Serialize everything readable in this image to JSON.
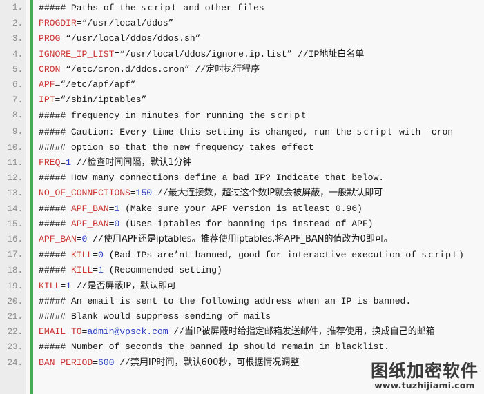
{
  "editor": {
    "title": "ddos.conf configuration listing",
    "colors": {
      "gutter_background": "#ececec",
      "gutter_rule": "#45ab57",
      "page_background": "#f8f8f8",
      "variable": "#cc3333",
      "number": "#2d3fc4",
      "text": "#161616",
      "lineno": "#8d8d8d"
    },
    "line_number_suffix": ".",
    "lines": [
      {
        "number": "1.",
        "tokens": [
          {
            "type": "plain",
            "text": "##### Paths of the "
          },
          {
            "type": "script",
            "text": "script"
          },
          {
            "type": "plain",
            "text": " and other files"
          }
        ]
      },
      {
        "number": "2.",
        "tokens": [
          {
            "type": "var",
            "text": "PROGDIR"
          },
          {
            "type": "plain",
            "text": "=“/usr/local/ddos”"
          }
        ]
      },
      {
        "number": "3.",
        "tokens": [
          {
            "type": "var",
            "text": "PROG"
          },
          {
            "type": "plain",
            "text": "=“/usr/local/ddos/ddos.sh”"
          }
        ]
      },
      {
        "number": "4.",
        "tokens": [
          {
            "type": "var",
            "text": "IGNORE_IP_LIST"
          },
          {
            "type": "plain",
            "text": "=“/usr/local/ddos/ignore.ip.list” //IP"
          },
          {
            "type": "cjk",
            "text": "地址白名单"
          }
        ]
      },
      {
        "number": "5.",
        "tokens": [
          {
            "type": "var",
            "text": "CRON"
          },
          {
            "type": "plain",
            "text": "=“/etc/cron.d/ddos.cron” //"
          },
          {
            "type": "cjk",
            "text": "定时执行程序"
          }
        ]
      },
      {
        "number": "6.",
        "tokens": [
          {
            "type": "var",
            "text": "APF"
          },
          {
            "type": "plain",
            "text": "=“/etc/apf/apf”"
          }
        ]
      },
      {
        "number": "7.",
        "tokens": [
          {
            "type": "var",
            "text": "IPT"
          },
          {
            "type": "plain",
            "text": "=“/sbin/iptables”"
          }
        ]
      },
      {
        "number": "8.",
        "tokens": [
          {
            "type": "plain",
            "text": "##### frequency in minutes for running the "
          },
          {
            "type": "script",
            "text": "script"
          }
        ]
      },
      {
        "number": "9.",
        "tokens": [
          {
            "type": "plain",
            "text": "##### Caution: Every time this setting is changed, run the "
          },
          {
            "type": "script",
            "text": "script"
          },
          {
            "type": "plain",
            "text": " with -cron"
          }
        ]
      },
      {
        "number": "10.",
        "tokens": [
          {
            "type": "plain",
            "text": "##### option so that the new frequency takes effect"
          }
        ]
      },
      {
        "number": "11.",
        "tokens": [
          {
            "type": "var",
            "text": "FREQ"
          },
          {
            "type": "plain",
            "text": "="
          },
          {
            "type": "num",
            "text": "1"
          },
          {
            "type": "plain",
            "text": " //"
          },
          {
            "type": "cjk",
            "text": "检查时间间隔，默认1分钟"
          }
        ]
      },
      {
        "number": "12.",
        "tokens": [
          {
            "type": "plain",
            "text": "##### How many connections define a bad IP? Indicate that below."
          }
        ]
      },
      {
        "number": "13.",
        "tokens": [
          {
            "type": "var",
            "text": "NO_OF_CONNECTIONS"
          },
          {
            "type": "plain",
            "text": "="
          },
          {
            "type": "num",
            "text": "150"
          },
          {
            "type": "plain",
            "text": " //"
          },
          {
            "type": "cjk",
            "text": "最大连接数，超过这个数IP就会被屏蔽，一般默认即可"
          }
        ]
      },
      {
        "number": "14.",
        "tokens": [
          {
            "type": "plain",
            "text": "##### "
          },
          {
            "type": "var",
            "text": "APF_BAN"
          },
          {
            "type": "plain",
            "text": "="
          },
          {
            "type": "num",
            "text": "1"
          },
          {
            "type": "plain",
            "text": " (Make sure your APF version is atleast 0.96)"
          }
        ]
      },
      {
        "number": "15.",
        "tokens": [
          {
            "type": "plain",
            "text": "##### "
          },
          {
            "type": "var",
            "text": "APF_BAN"
          },
          {
            "type": "plain",
            "text": "="
          },
          {
            "type": "num",
            "text": "0"
          },
          {
            "type": "plain",
            "text": " (Uses iptables for banning ips instead of APF)"
          }
        ]
      },
      {
        "number": "16.",
        "tokens": [
          {
            "type": "var",
            "text": "APF_BAN"
          },
          {
            "type": "plain",
            "text": "="
          },
          {
            "type": "num",
            "text": "0"
          },
          {
            "type": "plain",
            "text": " //"
          },
          {
            "type": "cjk",
            "text": "使用APF还是iptables。推荐使用iptables,将APF_BAN的值改为0即可。"
          }
        ]
      },
      {
        "number": "17.",
        "tokens": [
          {
            "type": "plain",
            "text": "##### "
          },
          {
            "type": "var",
            "text": "KILL"
          },
          {
            "type": "plain",
            "text": "="
          },
          {
            "type": "num",
            "text": "0"
          },
          {
            "type": "plain",
            "text": " (Bad IPs are’nt banned, good for interactive execution of "
          },
          {
            "type": "script",
            "text": "script"
          },
          {
            "type": "plain",
            "text": ")"
          }
        ]
      },
      {
        "number": "18.",
        "tokens": [
          {
            "type": "plain",
            "text": "##### "
          },
          {
            "type": "var",
            "text": "KILL"
          },
          {
            "type": "plain",
            "text": "="
          },
          {
            "type": "num",
            "text": "1"
          },
          {
            "type": "plain",
            "text": " (Recommended setting)"
          }
        ]
      },
      {
        "number": "19.",
        "tokens": [
          {
            "type": "var",
            "text": "KILL"
          },
          {
            "type": "plain",
            "text": "="
          },
          {
            "type": "num",
            "text": "1"
          },
          {
            "type": "plain",
            "text": " //"
          },
          {
            "type": "cjk",
            "text": "是否屏蔽IP，默认即可"
          }
        ]
      },
      {
        "number": "20.",
        "tokens": [
          {
            "type": "plain",
            "text": "##### An email is sent to the following address when an IP is banned."
          }
        ]
      },
      {
        "number": "21.",
        "tokens": [
          {
            "type": "plain",
            "text": "##### Blank would suppress sending of mails"
          }
        ]
      },
      {
        "number": "22.",
        "tokens": [
          {
            "type": "var",
            "text": "EMAIL_TO"
          },
          {
            "type": "plain",
            "text": "="
          },
          {
            "type": "num",
            "text": "admin@vpsck.com"
          },
          {
            "type": "plain",
            "text": " //"
          },
          {
            "type": "cjk",
            "text": "当IP被屏蔽时给指定邮箱发送邮件，推荐使用，换成自己的邮箱"
          }
        ]
      },
      {
        "number": "23.",
        "tokens": [
          {
            "type": "plain",
            "text": "##### Number of seconds the banned ip should remain in blacklist."
          }
        ]
      },
      {
        "number": "24.",
        "tokens": [
          {
            "type": "var",
            "text": "BAN_PERIOD"
          },
          {
            "type": "plain",
            "text": "="
          },
          {
            "type": "num",
            "text": "600"
          },
          {
            "type": "plain",
            "text": " //"
          },
          {
            "type": "cjk",
            "text": "禁用IP时间，默认600秒，可根据情况调整"
          }
        ]
      }
    ]
  },
  "watermark": {
    "brand": "图纸加密软件",
    "url": "www.tuzhijiami.com"
  }
}
